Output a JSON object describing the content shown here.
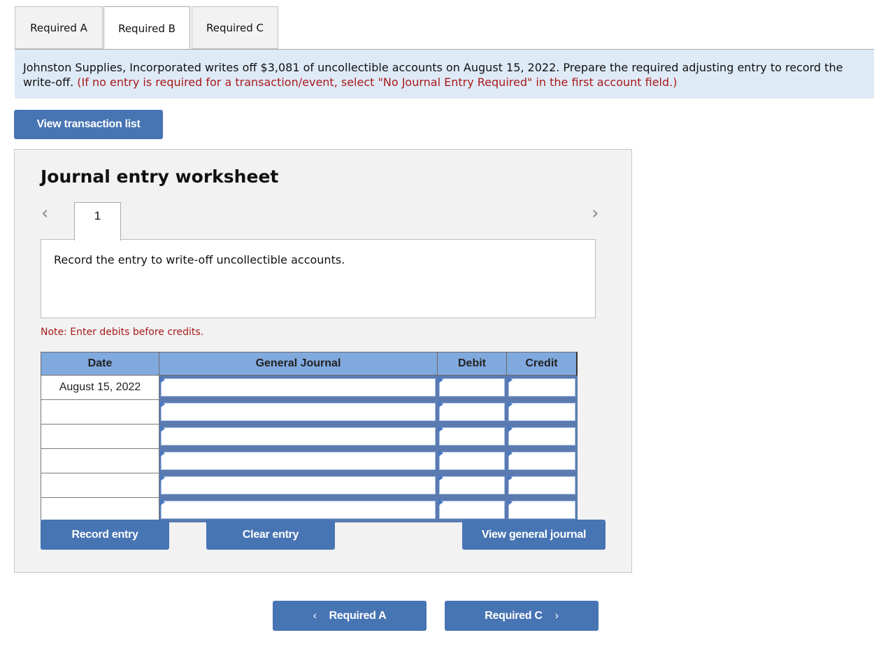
{
  "tabs": [
    {
      "label": "Required A",
      "active": false
    },
    {
      "label": "Required B",
      "active": true
    },
    {
      "label": "Required C",
      "active": false
    }
  ],
  "question": {
    "text": "Johnston Supplies, Incorporated writes off $3,081 of uncollectible accounts on August 15, 2022. Prepare the required adjusting entry to record the write-off.",
    "instruction": "(If no entry is required for a transaction/event, select \"No Journal Entry Required\" in the first account field.)"
  },
  "buttons": {
    "view_transaction_list": "View transaction list",
    "record_entry": "Record entry",
    "clear_entry": "Clear entry",
    "view_general_journal": "View general journal",
    "prev_required": "Required A",
    "next_required": "Required C"
  },
  "worksheet": {
    "title": "Journal entry worksheet",
    "current_entry": "1",
    "prev_arrow": "‹",
    "next_arrow": "›",
    "description": "Record the entry to write-off uncollectible accounts.",
    "note": "Note: Enter debits before credits."
  },
  "table": {
    "headers": {
      "date": "Date",
      "journal": "General Journal",
      "debit": "Debit",
      "credit": "Credit"
    },
    "rows": [
      {
        "date": "August 15, 2022",
        "account": "",
        "debit": "",
        "credit": ""
      },
      {
        "date": "",
        "account": "",
        "debit": "",
        "credit": ""
      },
      {
        "date": "",
        "account": "",
        "debit": "",
        "credit": ""
      },
      {
        "date": "",
        "account": "",
        "debit": "",
        "credit": ""
      },
      {
        "date": "",
        "account": "",
        "debit": "",
        "credit": ""
      },
      {
        "date": "",
        "account": "",
        "debit": "",
        "credit": ""
      }
    ]
  },
  "nav_icons": {
    "left": "‹",
    "right": "›"
  }
}
